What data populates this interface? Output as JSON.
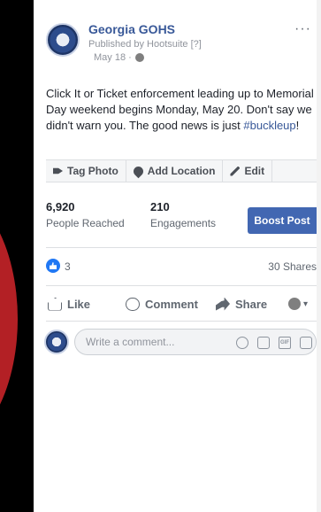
{
  "post": {
    "page_name": "Georgia GOHS",
    "published_by": "Published by Hootsuite [?]",
    "date": "May 18 ·",
    "more": "···",
    "text_main": "Click It or Ticket enforcement leading up to Memorial Day weekend begins Monday, May 20. Don't say we didn't warn you. The good news is just ",
    "hashtag": "#buckleup",
    "text_end": "!"
  },
  "actions": {
    "tag_photo": "Tag Photo",
    "add_location": "Add Location",
    "edit": "Edit"
  },
  "stats": {
    "people_reached_value": "6,920",
    "people_reached_label": "People Reached",
    "engagements_value": "210",
    "engagements_label": "Engagements",
    "boost_button": "Boost Post"
  },
  "reactions": {
    "count": "3",
    "shares": "30 Shares"
  },
  "ufi": {
    "like": "Like",
    "comment": "Comment",
    "share": "Share",
    "audience": "▾"
  },
  "comment_box": {
    "placeholder": "Write a comment...",
    "gif": "GIF"
  },
  "colors": {
    "brand_blue": "#4267b2",
    "link_blue": "#385898",
    "background_red": "#b32025"
  }
}
